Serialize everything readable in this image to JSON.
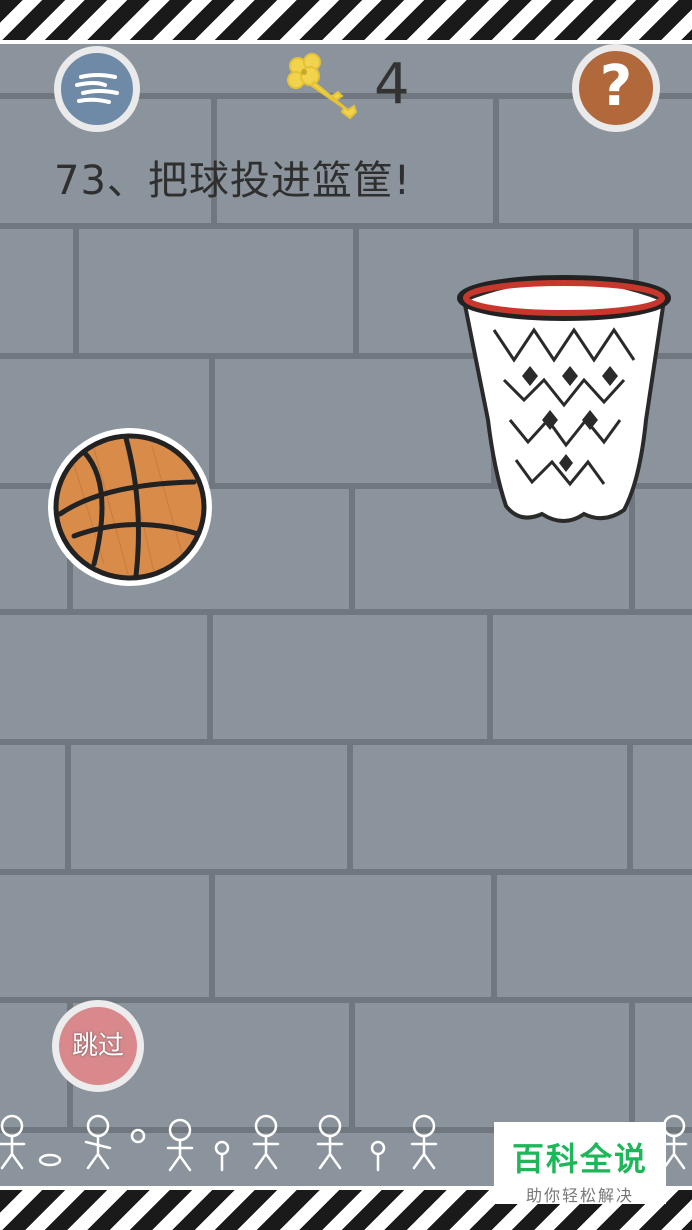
{
  "header": {
    "menu_icon": "menu-lines-icon",
    "key_icon": "key-icon",
    "key_count": "4",
    "help_icon": "question-mark-icon",
    "help_symbol": "?"
  },
  "level": {
    "title": "73、把球投进篮筐!"
  },
  "scene": {
    "ball": "basketball",
    "hoop": "basketball-hoop"
  },
  "footer": {
    "skip_label": "跳过"
  },
  "watermark": {
    "title": "百科全说",
    "subtitle": "助你轻松解决"
  },
  "colors": {
    "wall": "#8b949c",
    "mortar": "#70777e",
    "menu_button": "#6f8aa6",
    "help_button": "#b1683a",
    "skip_button": "#d9888c",
    "ball": "#d98c4a",
    "rim": "#c8372b",
    "key": "#f2d34e"
  }
}
